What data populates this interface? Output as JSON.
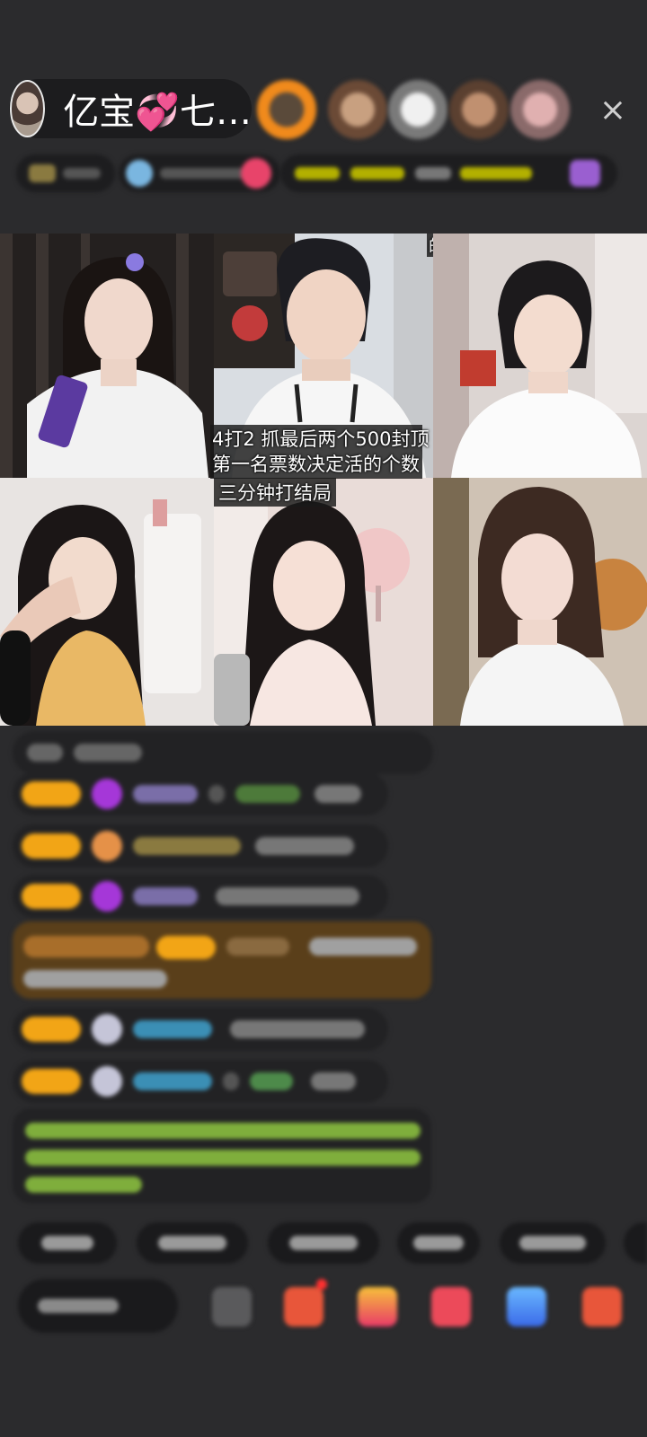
{
  "host": {
    "name": "亿宝💞七…"
  },
  "toolbar": {
    "close_icon": "×"
  },
  "video_grid": {
    "tiles": [
      {
        "name": "tile-1",
        "label": ""
      },
      {
        "name": "tile-2",
        "label": ""
      },
      {
        "name": "tile-3",
        "label": "的光"
      },
      {
        "name": "tile-4",
        "label": ""
      },
      {
        "name": "tile-5",
        "label": "三分钟打结局"
      },
      {
        "name": "tile-6",
        "label": ""
      }
    ],
    "game_rule_line1": "4打2  抓最后两个500封顶",
    "game_rule_line2": "第一名票数决定活的个数"
  },
  "colors": {
    "background": "#2b2b2d",
    "badge": "#f2a516",
    "chat_highlight": "#5a3f1a",
    "notice_text": "#7fae3c"
  },
  "icons": {
    "close": "close-icon",
    "gift": "gift-icon",
    "more": "more-icon"
  }
}
